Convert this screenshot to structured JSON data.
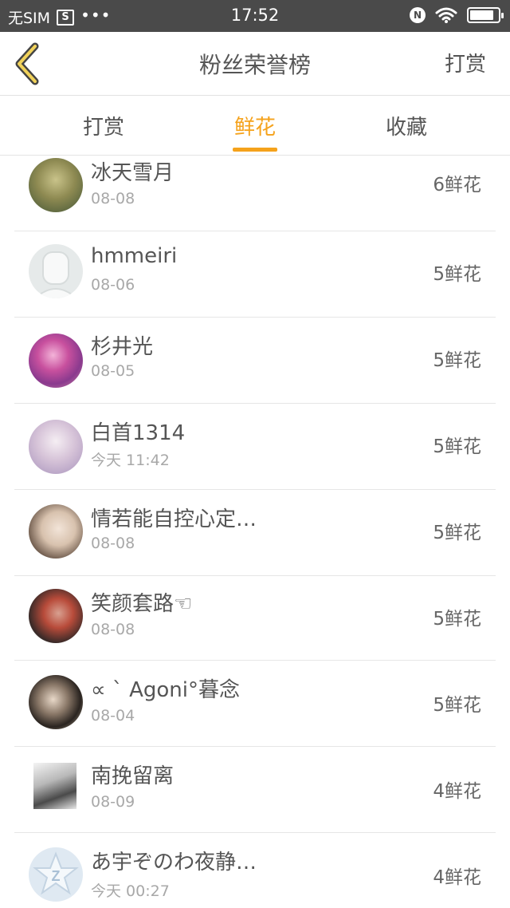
{
  "status_bar": {
    "carrier": "无SIM",
    "sim_icon_label": "S",
    "dots": "•••",
    "time": "17:52",
    "nfc_label": "N",
    "battery_level_percent": 85
  },
  "header": {
    "title": "粉丝荣誉榜",
    "right_action": "打赏"
  },
  "tabs": [
    {
      "label": "打赏",
      "active": false
    },
    {
      "label": "鲜花",
      "active": true
    },
    {
      "label": "收藏",
      "active": false
    }
  ],
  "accent_color": "#f5a21b",
  "fans": [
    {
      "name": "冰天雪月",
      "date": "08-08",
      "count": "6鲜花",
      "avatar": "scenic-avatar"
    },
    {
      "name": "hmmeiri",
      "date": "08-06",
      "count": "5鲜花",
      "avatar": "default-avatar"
    },
    {
      "name": "杉井光",
      "date": "08-05",
      "count": "5鲜花",
      "avatar": "anime-avatar"
    },
    {
      "name": "白首1314",
      "date": "今天 11:42",
      "count": "5鲜花",
      "avatar": "anime-avatar"
    },
    {
      "name": "情若能自控心定…",
      "date": "08-08",
      "count": "5鲜花",
      "avatar": "photo-avatar"
    },
    {
      "name": "笑颜套路☜",
      "date": "08-08",
      "count": "5鲜花",
      "avatar": "photo-avatar"
    },
    {
      "name": "∝ ˋ Agoni°暮念",
      "date": "08-04",
      "count": "5鲜花",
      "avatar": "photo-avatar"
    },
    {
      "name": "南挽留离",
      "date": "08-09",
      "count": "4鲜花",
      "avatar": "photo-avatar"
    },
    {
      "name": "あ宇ぞのわ夜静…",
      "date": "今天 00:27",
      "count": "4鲜花",
      "avatar": "app-logo-avatar"
    }
  ]
}
